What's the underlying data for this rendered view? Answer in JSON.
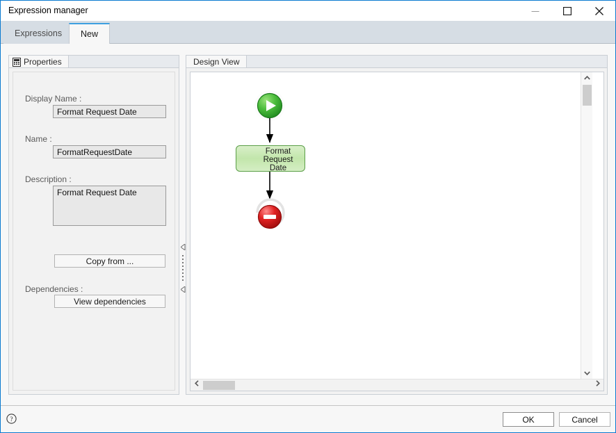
{
  "window": {
    "title": "Expression manager",
    "accent_border": "#0a7ad0",
    "controls": {
      "minimize": "minimize-icon",
      "maximize": "maximize-icon",
      "close": "close-icon"
    }
  },
  "tabs": [
    {
      "label": "Expressions",
      "active": false
    },
    {
      "label": "New",
      "active": true
    }
  ],
  "properties_panel": {
    "tab_label": "Properties",
    "tab_icon": "properties-document-icon",
    "fields": [
      {
        "label": "Display Name :",
        "value": "Format Request Date",
        "placeholder": ""
      },
      {
        "label": "Name :",
        "value": "FormatRequestDate",
        "placeholder": ""
      },
      {
        "label": "Description :",
        "value": "Format Request Date",
        "placeholder": ""
      }
    ],
    "copy_from_label": "Copy from ...",
    "dependencies_label": "Dependencies :",
    "view_dependencies_label": "View dependencies"
  },
  "splitter": {
    "collapse_left_icon": "triangle-left-icon",
    "grip_icon": "dotted-grip-icon"
  },
  "design_panel": {
    "tab_label": "Design View",
    "diagram": {
      "start_node": {
        "icon": "green-play-start-icon",
        "color": "#35a835"
      },
      "task_node": {
        "label": "Format\nRequest\nDate",
        "icon": "screen-display-icon",
        "badge_icon": "warning-triangle-icon",
        "border_color": "#5a9e47",
        "fill_color": "#c2e6ab"
      },
      "end_node": {
        "icon": "red-stop-end-icon",
        "color": "#d42020"
      },
      "connectors": [
        "start-to-task",
        "task-to-end"
      ]
    },
    "scrollbars": {
      "vertical_up": "chevron-up-icon",
      "vertical_down": "chevron-down-icon",
      "horizontal_left": "chevron-left-icon",
      "horizontal_right": "chevron-right-icon"
    }
  },
  "footer": {
    "help_icon": "help-question-icon",
    "ok_label": "OK",
    "cancel_label": "Cancel"
  }
}
